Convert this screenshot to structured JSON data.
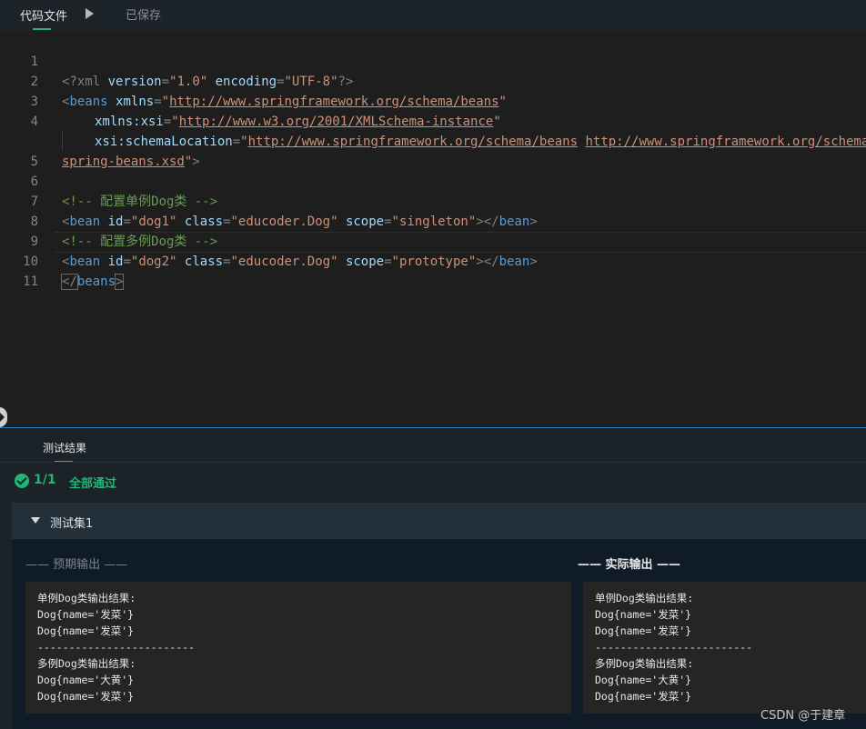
{
  "topbar": {
    "file_tab": "代码文件",
    "run_icon": "play-icon",
    "saved_status": "已保存"
  },
  "editor": {
    "line_numbers": [
      "1",
      "2",
      "3",
      "4",
      "",
      "5",
      "6",
      "7",
      "8",
      "9",
      "10",
      "11"
    ],
    "lines": {
      "l1": {
        "open": "<?xml ",
        "a1": "version",
        "eq1": "=",
        "v1": "\"1.0\"",
        "sp": " ",
        "a2": "encoding",
        "eq2": "=",
        "v2": "\"UTF-8\"",
        "close": "?>"
      },
      "l2": {
        "open": "<",
        "tag": "beans",
        "sp": " ",
        "a1": "xmlns",
        "eq1": "=",
        "q1": "\"",
        "url": "http://www.springframework.org/schema/beans",
        "q2": "\""
      },
      "l3": {
        "a1": "xmlns:xsi",
        "eq1": "=",
        "q1": "\"",
        "url": "http://www.w3.org/2001/XMLSchema-instance",
        "q2": "\""
      },
      "l4": {
        "a1": "xsi:schemaLocation",
        "eq1": "=",
        "q1": "\"",
        "url1": "http://www.springframework.org/schema/beans",
        "sp": " ",
        "url2": "http://www.springframework.org/schema/beans/"
      },
      "l4b": {
        "url": "spring-beans.xsd",
        "q2": "\"",
        "close": ">"
      },
      "l6": {
        "comment": "<!-- 配置单例Dog类 -->"
      },
      "l7": {
        "open": "<",
        "tag": "bean",
        "a1": "id",
        "v1": "\"dog1\"",
        "a2": "class",
        "v2": "\"educoder.Dog\"",
        "a3": "scope",
        "v3": "\"singleton\"",
        "mid": "></",
        "tag2": "bean",
        "close": ">"
      },
      "l8": {
        "comment": "<!-- 配置多例Dog类 -->"
      },
      "l9": {
        "open": "<",
        "tag": "bean",
        "a1": "id",
        "v1": "\"dog2\"",
        "a2": "class",
        "v2": "\"educoder.Dog\"",
        "a3": "scope",
        "v3": "\"prototype\"",
        "mid": "></",
        "tag2": "bean",
        "close": ">"
      },
      "l10": {
        "open": "</",
        "tag": "beans",
        "close": ">"
      }
    }
  },
  "panel": {
    "results_tab": "测试结果",
    "pass_count": "1/1",
    "pass_text": "全部通过",
    "suite_title": "测试集1",
    "expected_title": "—— 预期输出 ——",
    "actual_title": "—— 实际输出 ——",
    "expected_output": [
      "单例Dog类输出结果:",
      "Dog{name='发菜'}",
      "Dog{name='发菜'}",
      "-------------------------",
      "多例Dog类输出结果:",
      "Dog{name='大黄'}",
      "Dog{name='发菜'}"
    ],
    "actual_output": [
      "单例Dog类输出结果:",
      "Dog{name='发菜'}",
      "Dog{name='发菜'}",
      "-------------------------",
      "多例Dog类输出结果:",
      "Dog{name='大黄'}",
      "Dog{name='发菜'}"
    ]
  },
  "watermark": "CSDN @于建章",
  "colors": {
    "accent": "#23b573",
    "splitter": "#2a7fc1",
    "tag": "#569cd6",
    "attr": "#9cdcfe",
    "string": "#ce9178",
    "comment": "#6a9955"
  }
}
